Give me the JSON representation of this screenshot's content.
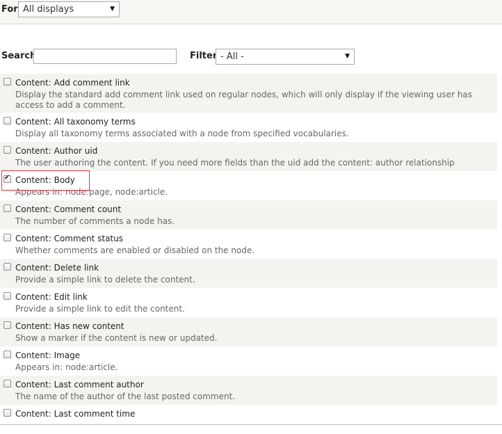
{
  "for_bar": {
    "label": "For",
    "select_value": "All displays"
  },
  "search": {
    "label": "Search",
    "value": ""
  },
  "filter": {
    "label": "Filter",
    "select_value": "- All -"
  },
  "items": [
    {
      "title": "Content: Add comment link",
      "desc": "Display the standard add comment link used on regular nodes, which will only display if the viewing user has access to add a comment.",
      "checked": false
    },
    {
      "title": "Content: All taxonomy terms",
      "desc": "Display all taxonomy terms associated with a node from specified vocabularies.",
      "checked": false
    },
    {
      "title": "Content: Author uid",
      "desc": "The user authoring the content. If you need more fields than the uid add the content: author relationship",
      "checked": false
    },
    {
      "title": "Content: Body",
      "desc": "Appears in: node:page, node:article.",
      "checked": true
    },
    {
      "title": "Content: Comment count",
      "desc": "The number of comments a node has.",
      "checked": false
    },
    {
      "title": "Content: Comment status",
      "desc": "Whether comments are enabled or disabled on the node.",
      "checked": false
    },
    {
      "title": "Content: Delete link",
      "desc": "Provide a simple link to delete the content.",
      "checked": false
    },
    {
      "title": "Content: Edit link",
      "desc": "Provide a simple link to edit the content.",
      "checked": false
    },
    {
      "title": "Content: Has new content",
      "desc": "Show a marker if the content is new or updated.",
      "checked": false
    },
    {
      "title": "Content: Image",
      "desc": "Appears in: node:article.",
      "checked": false
    },
    {
      "title": "Content: Last comment author",
      "desc": "The name of the author of the last posted comment.",
      "checked": false
    },
    {
      "title": "Content: Last comment time",
      "desc": "",
      "checked": false
    }
  ],
  "icons": {
    "dropdown": "chevron-down-icon",
    "checkbox_checked": "check-icon"
  },
  "colors": {
    "highlight_border": "#d9373f",
    "row_alt": "#f3f3ef"
  }
}
